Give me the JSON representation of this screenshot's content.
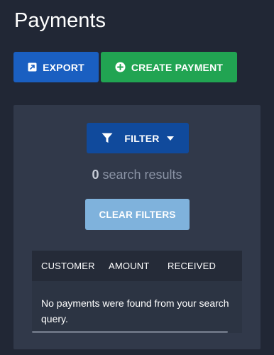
{
  "page": {
    "title": "Payments"
  },
  "toolbar": {
    "export_label": "EXPORT",
    "create_label": "CREATE PAYMENT"
  },
  "filters": {
    "filter_label": "FILTER",
    "result_count": "0",
    "result_text": "search results",
    "clear_label": "CLEAR FILTERS"
  },
  "table": {
    "columns": [
      "CUSTOMER",
      "AMOUNT",
      "RECEIVED"
    ],
    "empty_message": "No payments were found from your search query."
  },
  "colors": {
    "background": "#212735",
    "export": "#1a5fc1",
    "create": "#21a452",
    "filter": "#104a9c",
    "clear": "#7fb2dc",
    "panel": "#31394a"
  },
  "icons": {
    "export": "external-link-icon",
    "create": "plus-circle-icon",
    "filter": "funnel-icon",
    "caret": "caret-down-icon"
  }
}
